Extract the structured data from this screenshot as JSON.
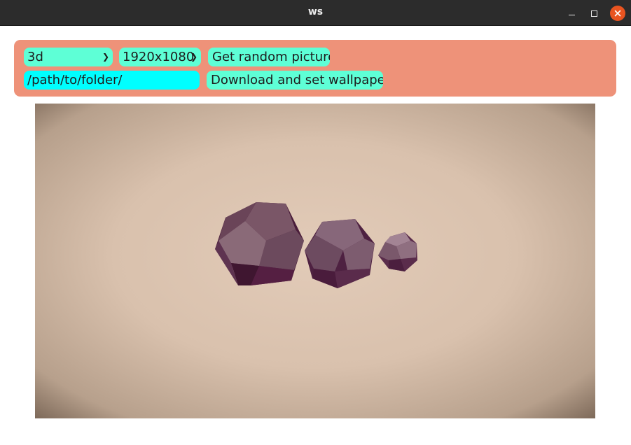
{
  "window": {
    "title": "ws"
  },
  "toolbar": {
    "category_select": {
      "value": "3d"
    },
    "resolution_select": {
      "value": "1920x1080"
    },
    "random_button_label": "Get random picture",
    "path_input": {
      "value": "/path/to/folder/"
    },
    "download_button_label": "Download and set wallpaper"
  },
  "colors": {
    "toolbar_bg": "#ee9279",
    "control_bg": "#5effd6",
    "path_input_bg": "#00ffff",
    "close_button": "#e95420",
    "titlebar_bg": "#2c2c2c"
  },
  "icons": {
    "minimize": "minimize-icon",
    "maximize": "maximize-icon",
    "close": "close-icon",
    "dropdown": "chevron-down-icon"
  }
}
